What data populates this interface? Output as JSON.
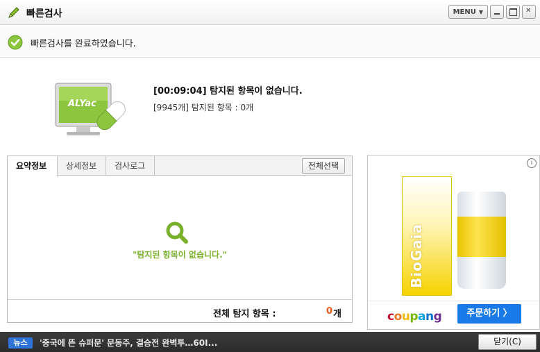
{
  "titlebar": {
    "title": "빠른검사",
    "menu_label": "MENU"
  },
  "status": {
    "message": "빠른검사를 완료하였습니다."
  },
  "summary": {
    "monitor_brand": "ALYac",
    "headline": "[00:09:04]  탐지된 항목이 없습니다.",
    "detail": "[9945개] 탐지된 항목 : 0개"
  },
  "tabs": {
    "items": [
      "요약정보",
      "상세정보",
      "검사로그"
    ],
    "select_all": "전체선택"
  },
  "results": {
    "empty_message": "\"탐지된 항목이 없습니다.\"",
    "total_label": "전체  탐지  항목 :",
    "total_count": "0",
    "total_unit": "개"
  },
  "ad": {
    "info_icon": "info-icon",
    "brand": "BioGaia",
    "seller": "coupang",
    "order_button": "주문하기 〉",
    "seller_letter_colors": [
      "#c8102e",
      "#e87722",
      "#f2b705",
      "#7ab800",
      "#00a3e0",
      "#0072ce",
      "#6e2c8f"
    ]
  },
  "bottombar": {
    "news_tag": "뉴스",
    "news_text": "'중국에 뜬 슈퍼문' 문동주, 결승전 완벽투…60I...",
    "close_button": "닫기(C)"
  },
  "colors": {
    "accent_green": "#7ab02a",
    "count_orange": "#e85d1a",
    "news_blue": "#2f73d8",
    "order_blue": "#1a7ae8"
  }
}
